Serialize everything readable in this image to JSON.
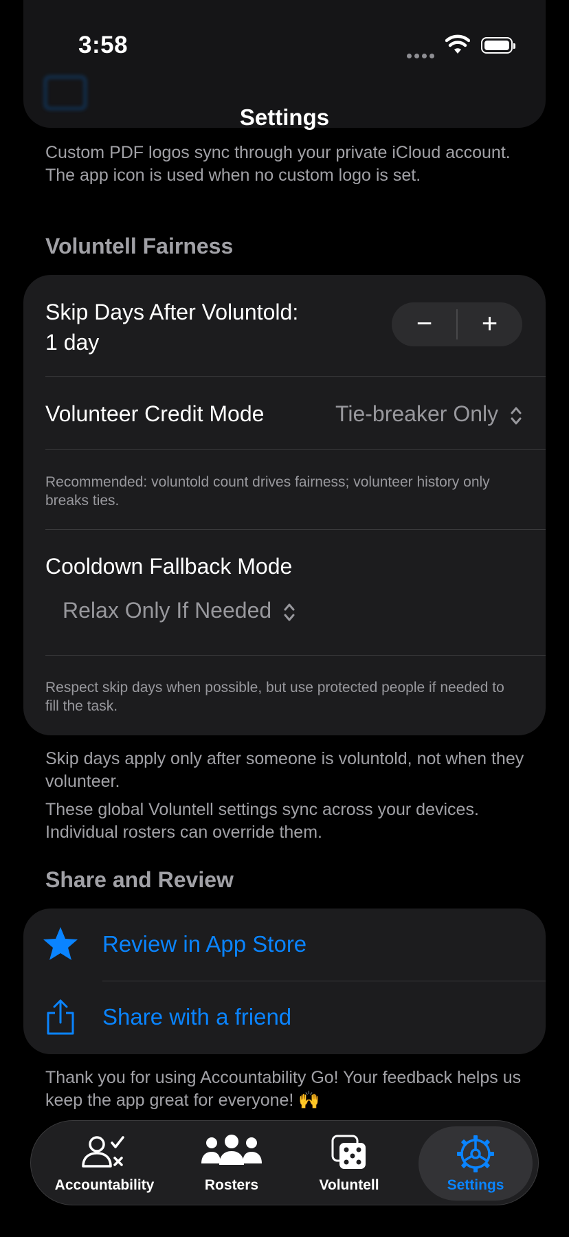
{
  "status_bar": {
    "time": "3:58"
  },
  "nav": {
    "title": "Settings"
  },
  "logo_section": {
    "footer": "Custom PDF logos sync through your private iCloud account. The app icon is used when no custom logo is set."
  },
  "fairness": {
    "header": "Voluntell Fairness",
    "skip_days_label": "Skip Days After Voluntold:",
    "skip_days_value": "1 day",
    "stepper_minus": "−",
    "stepper_plus": "+",
    "credit_mode_label": "Volunteer Credit Mode",
    "credit_mode_value": "Tie-breaker Only",
    "credit_mode_note": "Recommended: voluntold count drives fairness; volunteer history only breaks ties.",
    "cooldown_label": "Cooldown Fallback Mode",
    "cooldown_value": "Relax Only If Needed",
    "cooldown_note": "Respect skip days when possible, but use protected people if needed to fill the task.",
    "footer_1": "Skip days apply only after someone is voluntold, not when they volunteer.",
    "footer_2": "These global Voluntell settings sync across your devices. Individual rosters can override them."
  },
  "share": {
    "header": "Share and Review",
    "review_label": "Review in App Store",
    "share_label": "Share with a friend",
    "footer": "Thank you for using Accountability Go! Your feedback helps us keep the app great for everyone! 🙌"
  },
  "tabs": [
    {
      "label": "Accountability",
      "icon": "person-check-icon"
    },
    {
      "label": "Rosters",
      "icon": "people-icon"
    },
    {
      "label": "Voluntell",
      "icon": "dice-icon"
    },
    {
      "label": "Settings",
      "icon": "gear-icon",
      "active": true
    }
  ],
  "colors": {
    "accent": "#0a84ff",
    "background": "#000000",
    "card": "#1c1c1e",
    "secondary_text": "#98989d"
  }
}
